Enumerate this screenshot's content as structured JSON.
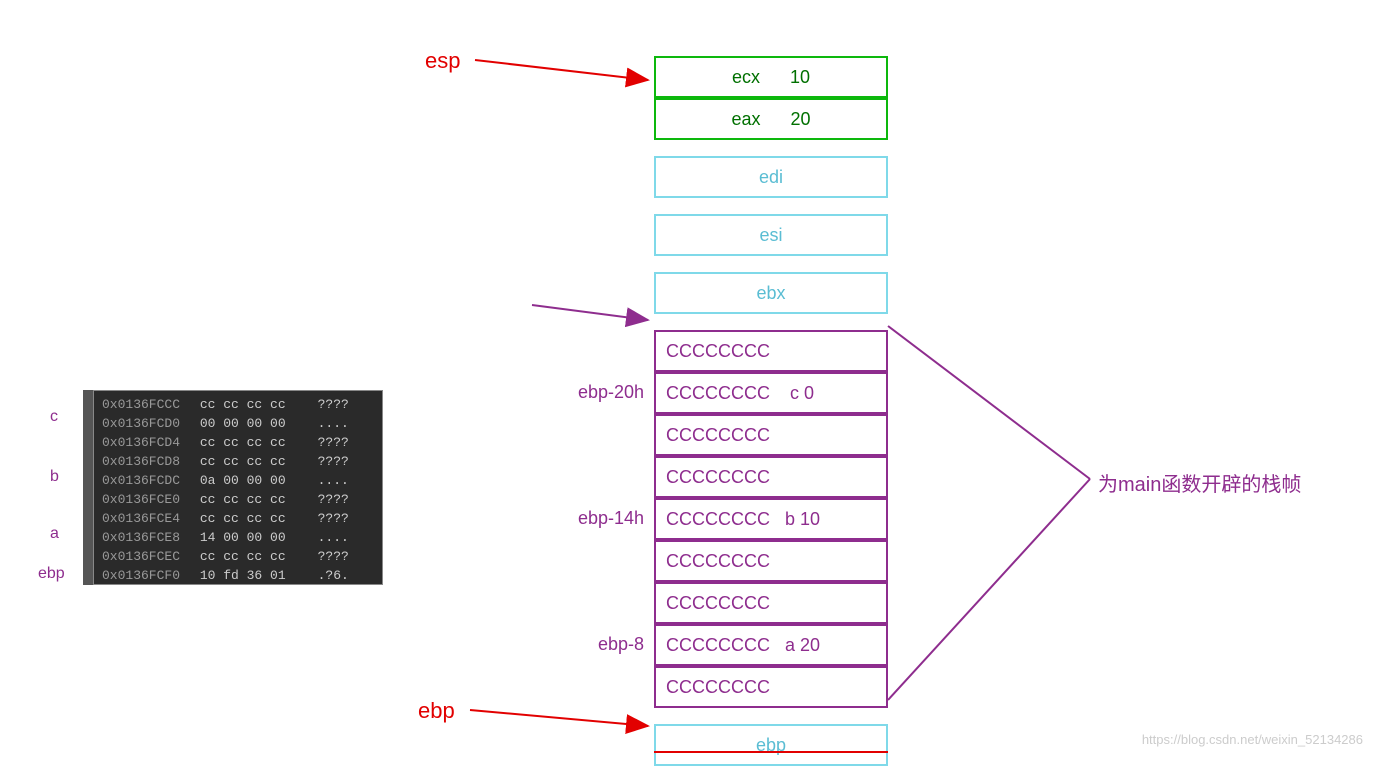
{
  "pointers": {
    "esp": "esp",
    "ebp": "ebp"
  },
  "stack_cells": {
    "ecx": {
      "reg": "ecx",
      "val": "10"
    },
    "eax": {
      "reg": "eax",
      "val": "20"
    },
    "edi": "edi",
    "esi": "esi",
    "ebx": "ebx",
    "fill": "CCCCCCCC",
    "c": {
      "text": "CCCCCCCC",
      "var": "c 0"
    },
    "b": {
      "text": "CCCCCCCC",
      "var": "b 10"
    },
    "a": {
      "text": "CCCCCCCC",
      "var": "a 20"
    },
    "base": "ebp"
  },
  "offsets": {
    "c": "ebp-20h",
    "b": "ebp-14h",
    "a": "ebp-8"
  },
  "annotation": "为main函数开辟的栈帧",
  "mem_labels": {
    "c": "c",
    "b": "b",
    "a": "a",
    "ebp": "ebp"
  },
  "memory_rows": [
    {
      "addr": "0x0136FCCC",
      "bytes": "cc cc cc cc",
      "ascii": "????"
    },
    {
      "addr": "0x0136FCD0",
      "bytes": "00 00 00 00",
      "ascii": "...."
    },
    {
      "addr": "0x0136FCD4",
      "bytes": "cc cc cc cc",
      "ascii": "????"
    },
    {
      "addr": "0x0136FCD8",
      "bytes": "cc cc cc cc",
      "ascii": "????"
    },
    {
      "addr": "0x0136FCDC",
      "bytes": "0a 00 00 00",
      "ascii": "...."
    },
    {
      "addr": "0x0136FCE0",
      "bytes": "cc cc cc cc",
      "ascii": "????"
    },
    {
      "addr": "0x0136FCE4",
      "bytes": "cc cc cc cc",
      "ascii": "????"
    },
    {
      "addr": "0x0136FCE8",
      "bytes": "14 00 00 00",
      "ascii": "...."
    },
    {
      "addr": "0x0136FCEC",
      "bytes": "cc cc cc cc",
      "ascii": "????"
    },
    {
      "addr": "0x0136FCF0",
      "bytes": "10 fd 36 01",
      "ascii": ".?6."
    }
  ],
  "watermark": "https://blog.csdn.net/weixin_52134286",
  "chart_data": {
    "type": "table",
    "title": "x86 main() stack frame layout",
    "stack": [
      {
        "offset": "esp",
        "content": "ecx (value 10 pushed)",
        "color": "green"
      },
      {
        "offset": "",
        "content": "eax (value 20 pushed)",
        "color": "green"
      },
      {
        "offset": "",
        "content": "edi (saved)",
        "color": "cyan"
      },
      {
        "offset": "",
        "content": "esi (saved)",
        "color": "cyan"
      },
      {
        "offset": "",
        "content": "ebx (saved)",
        "color": "cyan"
      },
      {
        "offset": "",
        "content": "CCCCCCCC (padding)"
      },
      {
        "offset": "ebp-20h",
        "content": "local c = 0"
      },
      {
        "offset": "",
        "content": "CCCCCCCC"
      },
      {
        "offset": "",
        "content": "CCCCCCCC"
      },
      {
        "offset": "ebp-14h",
        "content": "local b = 10"
      },
      {
        "offset": "",
        "content": "CCCCCCCC"
      },
      {
        "offset": "",
        "content": "CCCCCCCC"
      },
      {
        "offset": "ebp-8",
        "content": "local a = 20"
      },
      {
        "offset": "",
        "content": "CCCCCCCC"
      },
      {
        "offset": "ebp",
        "content": "saved ebp",
        "color": "cyan"
      }
    ],
    "brace_annotation": "为main函数开辟的栈帧 (stack frame allocated for main)",
    "memory_dump": {
      "base": "0x0136FCCC",
      "rows": [
        [
          "0x0136FCCC",
          "cc cc cc cc",
          "????"
        ],
        [
          "0x0136FCD0",
          "00 00 00 00",
          "....",
          "c"
        ],
        [
          "0x0136FCD4",
          "cc cc cc cc",
          "????"
        ],
        [
          "0x0136FCD8",
          "cc cc cc cc",
          "????"
        ],
        [
          "0x0136FCDC",
          "0a 00 00 00",
          "....",
          "b"
        ],
        [
          "0x0136FCE0",
          "cc cc cc cc",
          "????"
        ],
        [
          "0x0136FCE4",
          "cc cc cc cc",
          "????"
        ],
        [
          "0x0136FCE8",
          "14 00 00 00",
          "....",
          "a"
        ],
        [
          "0x0136FCEC",
          "cc cc cc cc",
          "????"
        ],
        [
          "0x0136FCF0",
          "10 fd 36 01",
          ".?6.",
          "ebp"
        ]
      ]
    }
  }
}
